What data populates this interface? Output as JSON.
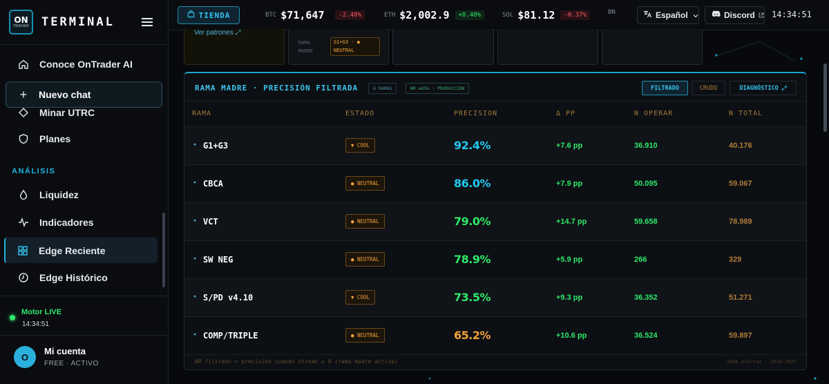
{
  "sidebar": {
    "logo_top": "ON",
    "logo_bottom": "TRADER",
    "brand": "TERMINAL",
    "items": [
      {
        "label": "Conoce OnTrader AI",
        "icon": "home-icon"
      },
      {
        "label": "Nuevo chat",
        "icon": "plus-icon"
      },
      {
        "label": "Minar UTRC",
        "icon": "diamond-icon"
      },
      {
        "label": "Planes",
        "icon": "shield-icon"
      }
    ],
    "section": "ANÁLISIS",
    "analysis": [
      {
        "label": "Liquidez",
        "icon": "droplet-icon"
      },
      {
        "label": "Indicadores",
        "icon": "pulse-icon"
      },
      {
        "label": "Edge Reciente",
        "icon": "grid-icon",
        "active": true
      },
      {
        "label": "Edge Histórico",
        "icon": "clock-icon"
      }
    ],
    "motor": "Motor LIVE",
    "motor_time": "14:34:51",
    "account": {
      "avatar": "O",
      "name": "Mi cuenta",
      "plan": "FREE · ACTIVO"
    }
  },
  "topbar": {
    "tienda": "TIENDA",
    "tickers": [
      {
        "sym": "BTC",
        "price": "$71,647",
        "chg": "-2.48%",
        "dir": "neg"
      },
      {
        "sym": "ETH",
        "price": "$2,002.9",
        "chg": "+0.40%",
        "dir": "pos"
      },
      {
        "sym": "SOL",
        "price": "$81.12",
        "chg": "-0.37%",
        "dir": "neg"
      },
      {
        "sym": "BN",
        "price": "",
        "chg": "",
        "dir": ""
      }
    ],
    "language": "Español",
    "discord": "Discord",
    "clock": "14:34:51"
  },
  "cards": {
    "ver_patrones": "Ver patrones ⤢",
    "mini_rama": "RAMA",
    "mini_madre": "MADRE",
    "mini_val1": "G1+G3 · ●",
    "mini_val2": "NEUTRAL"
  },
  "panel": {
    "title": "RAMA MADRE · PRECISIÓN FILTRADA",
    "pill1": "6 RAMAS",
    "pill2": "WR ≥65% · PRODUCCIÓN",
    "seg_filtrado": "FILTRADO",
    "seg_crudo": "CRUDO",
    "seg_diag": "DIAGNÓSTICO ⤢",
    "headers": [
      "RAMA",
      "ESTADO",
      "PRECISION",
      "Δ PP",
      "N OPERAR",
      "N TOTAL"
    ],
    "rows": [
      {
        "rama": "G1+G3",
        "estado": "▼ COOL",
        "prec": "92.4%",
        "pcolor": "#22c8f0",
        "dpp": "+7.6 pp",
        "nop": "36.910",
        "ntot": "40.176"
      },
      {
        "rama": "CBCA",
        "estado": "● NEUTRAL",
        "prec": "86.0%",
        "pcolor": "#22c8f0",
        "dpp": "+7.9 pp",
        "nop": "50.095",
        "ntot": "59.067"
      },
      {
        "rama": "VCT",
        "estado": "● NEUTRAL",
        "prec": "79.0%",
        "pcolor": "#2ee86a",
        "dpp": "+14.7 pp",
        "nop": "59.658",
        "ntot": "78.989"
      },
      {
        "rama": "SW NEG",
        "estado": "● NEUTRAL",
        "prec": "78.9%",
        "pcolor": "#2ee86a",
        "dpp": "+5.9 pp",
        "nop": "266",
        "ntot": "329"
      },
      {
        "rama": "S/PD v4.10",
        "estado": "▼ COOL",
        "prec": "73.5%",
        "pcolor": "#2ee86a",
        "dpp": "+9.3 pp",
        "nop": "36.352",
        "ntot": "51.271"
      },
      {
        "rama": "COMP/TRIPLE",
        "estado": "● NEUTRAL",
        "prec": "65.2%",
        "pcolor": "#f2a23c",
        "dpp": "+10.6 pp",
        "nop": "36.524",
        "ntot": "59.897"
      }
    ],
    "footnote": "WR filtrado = precisión cuando streak ≥ 0 (rama madre activa)",
    "footer_right": "288K alertas · 2018-2025"
  }
}
